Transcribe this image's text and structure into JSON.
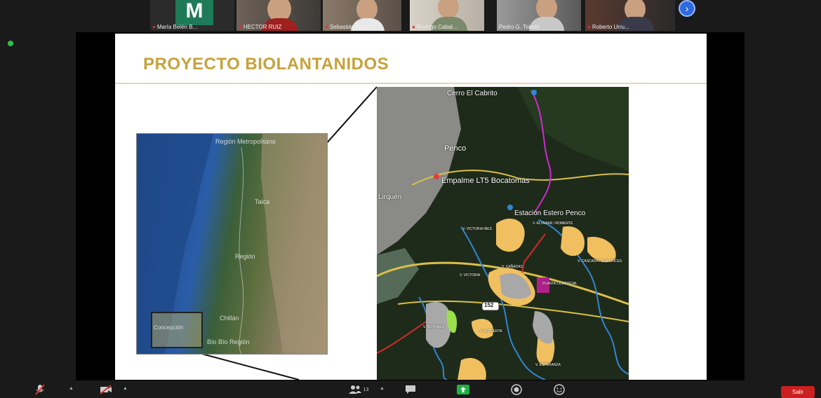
{
  "participants": [
    {
      "name": "María Belén B...",
      "initial": "M",
      "video": false
    },
    {
      "name": "HECTOR RUIZ",
      "video": true
    },
    {
      "name": "Sebastián Rojas...",
      "video": true
    },
    {
      "name": "Rodrigo Cabal...",
      "video": true
    },
    {
      "name": "Pedro G. Toledo",
      "video": true
    },
    {
      "name": "Roberto Urru...",
      "video": true
    }
  ],
  "strip_next_icon": "chevron-right-icon",
  "slide": {
    "title": "PROYECTO BIOLANTANIDOS",
    "overview_map_labels": [
      "Región Metropolitana",
      "Talca",
      "Región",
      "Chillán",
      "Concepción",
      "Bío Bío Región"
    ],
    "detail_map_labels": {
      "cabrito": "Cerro El Cabrito",
      "penco": "Penco",
      "empalme": "Empalme LT5 Bocatomas",
      "estacion": "Estación Estero Penco",
      "lirquen": "Lirquén",
      "route": "152",
      "small": [
        "V. VICTORIA INES",
        "V. ALTAMAR / ROMENTE",
        "V. CASCADA / LOS LINCES",
        "V. CAÑADAS",
        "V. VICTORIA",
        "PLANTA COMERCIAL",
        "V. BOTONES",
        "V. LA PUERTA",
        "V. ESPERANZA"
      ]
    },
    "colors": {
      "title": "#c8a13a",
      "deposit": "#f0c060",
      "pit": "#a8a8a8",
      "road": "#d8c04a",
      "river": "#2f86d6",
      "line_magenta": "#d02ad0",
      "line_red": "#d42a2a",
      "plant": "#b0208a"
    }
  },
  "toolbar": {
    "items": [
      {
        "name": "mute-button",
        "icon": "microphone-muted-icon"
      },
      {
        "name": "video-button",
        "icon": "video-off-icon"
      },
      {
        "name": "participants-button",
        "icon": "participants-icon",
        "count": "13"
      },
      {
        "name": "chat-button",
        "icon": "chat-icon"
      },
      {
        "name": "share-screen-button",
        "icon": "share-screen-icon"
      },
      {
        "name": "record-button",
        "icon": "record-icon"
      },
      {
        "name": "reactions-button",
        "icon": "reactions-icon"
      }
    ],
    "leave_label": "Salir",
    "leave_color": "#cc1f1f"
  }
}
